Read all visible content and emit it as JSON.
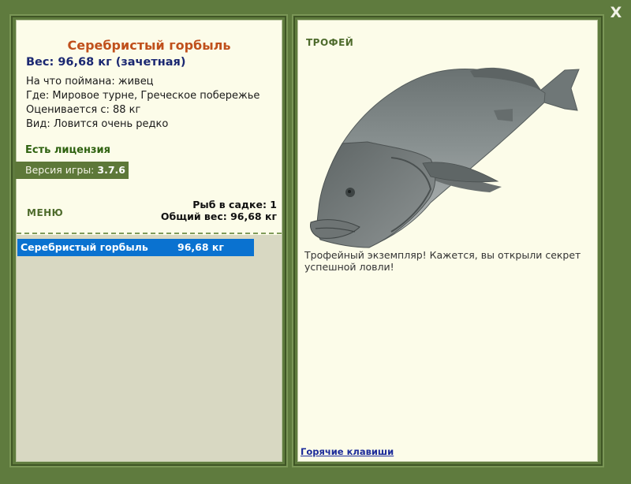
{
  "window": {
    "close_label": "X"
  },
  "fish": {
    "name": "Серебристый горбыль",
    "weight_line": "Вес: 96,68 кг (зачетная)",
    "info": [
      "На что поймана: живец",
      "Где: Мировое турне, Греческое побережье",
      "Оценивается с: 88 кг",
      "Вид: Ловится очень редко"
    ]
  },
  "license_label": "Есть лицензия",
  "version": {
    "label": "Версия игры:",
    "value": "3.7.6"
  },
  "menu_label": "МЕНЮ",
  "stats": {
    "fish_count": "Рыб в садке: 1",
    "total_weight": "Общий вес: 96,68 кг"
  },
  "keepnet": [
    {
      "name": "Серебристый горбыль",
      "weight": "96,68 кг"
    }
  ],
  "trophy": {
    "title": "ТРОФЕЙ",
    "description": "Трофейный экземпляр! Кажется, вы открыли секрет успешной ловли!",
    "hotkeys_link": "Горячие клавиши"
  },
  "colors": {
    "background": "#5f7b3e",
    "panel": "#fcfce9",
    "fish_name": "#c0501c",
    "weight": "#1b2872",
    "license": "#2f6210",
    "selection": "#0a72d0"
  }
}
